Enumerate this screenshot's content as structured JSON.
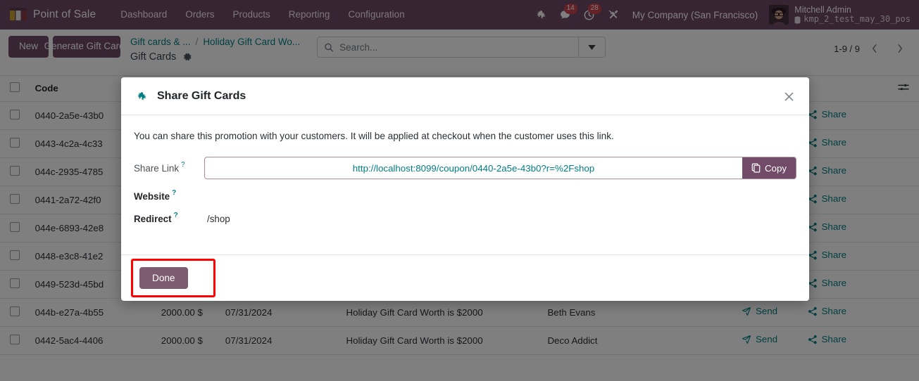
{
  "navbar": {
    "brand": "Point of Sale",
    "menu": [
      "Dashboard",
      "Orders",
      "Products",
      "Reporting",
      "Configuration"
    ],
    "icons": {
      "debug": "bug-icon",
      "messages": "chat-icon",
      "activities": "clock-icon",
      "apps": "tools-icon"
    },
    "messages_count": "14",
    "activities_count": "28",
    "company": "My Company (San Francisco)",
    "user_name": "Mitchell Admin",
    "user_db": "kmp_2_test_may_30_pos",
    "brand_color": "#714B67"
  },
  "control_panel": {
    "new_label": "New",
    "generate_label": "Generate Gift Cards",
    "breadcrumb": [
      "Gift cards & ...",
      "/",
      "Holiday Gift Card Wo..."
    ],
    "view_title": "Gift Cards",
    "search_placeholder": "Search...",
    "search_value": "",
    "pager": "1-9 / 9"
  },
  "list": {
    "columns": [
      "",
      "Code",
      "",
      "",
      "",
      "",
      "",
      "",
      ""
    ],
    "header_code": "Code",
    "rows": [
      {
        "code": "0440-2a5e-43b0",
        "amount": "",
        "date": "",
        "description": "",
        "partner": "",
        "send": "",
        "share": "Share"
      },
      {
        "code": "0443-4c2a-4c33",
        "amount": "",
        "date": "",
        "description": "",
        "partner": "",
        "send": "",
        "share": "Share"
      },
      {
        "code": "044c-2935-4785",
        "amount": "",
        "date": "",
        "description": "",
        "partner": "",
        "send": "",
        "share": "Share"
      },
      {
        "code": "0441-2a72-42f0",
        "amount": "",
        "date": "",
        "description": "",
        "partner": "",
        "send": "",
        "share": "Share"
      },
      {
        "code": "044e-6893-42e8",
        "amount": "",
        "date": "",
        "description": "",
        "partner": "",
        "send": "",
        "share": "Share"
      },
      {
        "code": "0448-e3c8-41e2",
        "amount": "",
        "date": "",
        "description": "",
        "partner": "",
        "send": "",
        "share": "Share"
      },
      {
        "code": "0449-523d-45bd",
        "amount": "",
        "date": "",
        "description": "",
        "partner": "",
        "send": "",
        "share": "Share"
      },
      {
        "code": "044b-e27a-4b55",
        "amount": "2000.00 $",
        "date": "07/31/2024",
        "description": "Holiday Gift Card Worth is $2000",
        "partner": "Beth Evans",
        "send": "Send",
        "share": "Share"
      },
      {
        "code": "0442-5ac4-4406",
        "amount": "2000.00 $",
        "date": "07/31/2024",
        "description": "Holiday Gift Card Worth is $2000",
        "partner": "Deco Addict",
        "send": "Send",
        "share": "Share"
      }
    ]
  },
  "modal": {
    "title": "Share Gift Cards",
    "intro": "You can share this promotion with your customers. It will be applied at checkout when the customer uses this link.",
    "share_link_label": "Share Link",
    "share_link_value": "http://localhost:8099/coupon/0440-2a5e-43b0?r=%2Fshop",
    "copy_label": "Copy",
    "website_label": "Website",
    "website_value": "",
    "redirect_label": "Redirect",
    "redirect_value": "/shop",
    "tip_marker": "?",
    "done_label": "Done",
    "highlight_color": "#ff0000"
  }
}
